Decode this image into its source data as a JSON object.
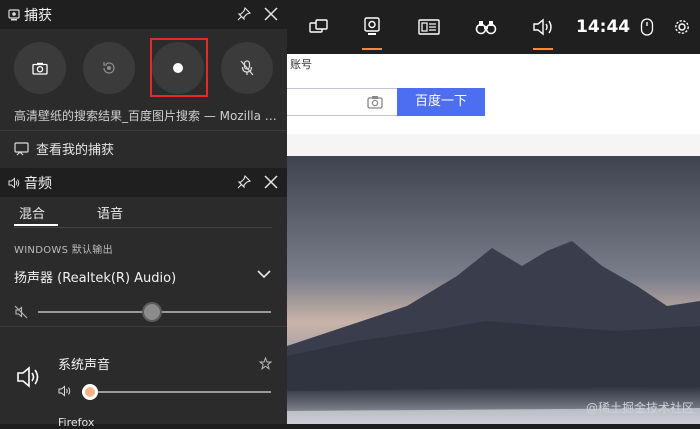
{
  "topbar": {
    "time": "14:44"
  },
  "capture": {
    "title": "捕获",
    "window_title": "高清壁纸的搜索结果_百度图片搜索 — Mozilla Firefox",
    "view_captures": "查看我的捕获",
    "buttons": [
      "camera-icon",
      "record-last-icon",
      "record-icon",
      "mic-off-icon"
    ]
  },
  "audio": {
    "title": "音频",
    "tabs": {
      "mix": "混合",
      "voice": "语音"
    },
    "output_label": "WINDOWS 默认输出",
    "device": "扬声器 (Realtek(R) Audio)",
    "master_volume": 0.49,
    "system_sound": "系统声音",
    "system_volume": 0.0,
    "next_app": "Firefox",
    "accent": "#ff8a3d"
  },
  "web": {
    "partial_text": "账号",
    "search_button": "百度一下"
  },
  "watermark": "@稀土掘金技术社区"
}
